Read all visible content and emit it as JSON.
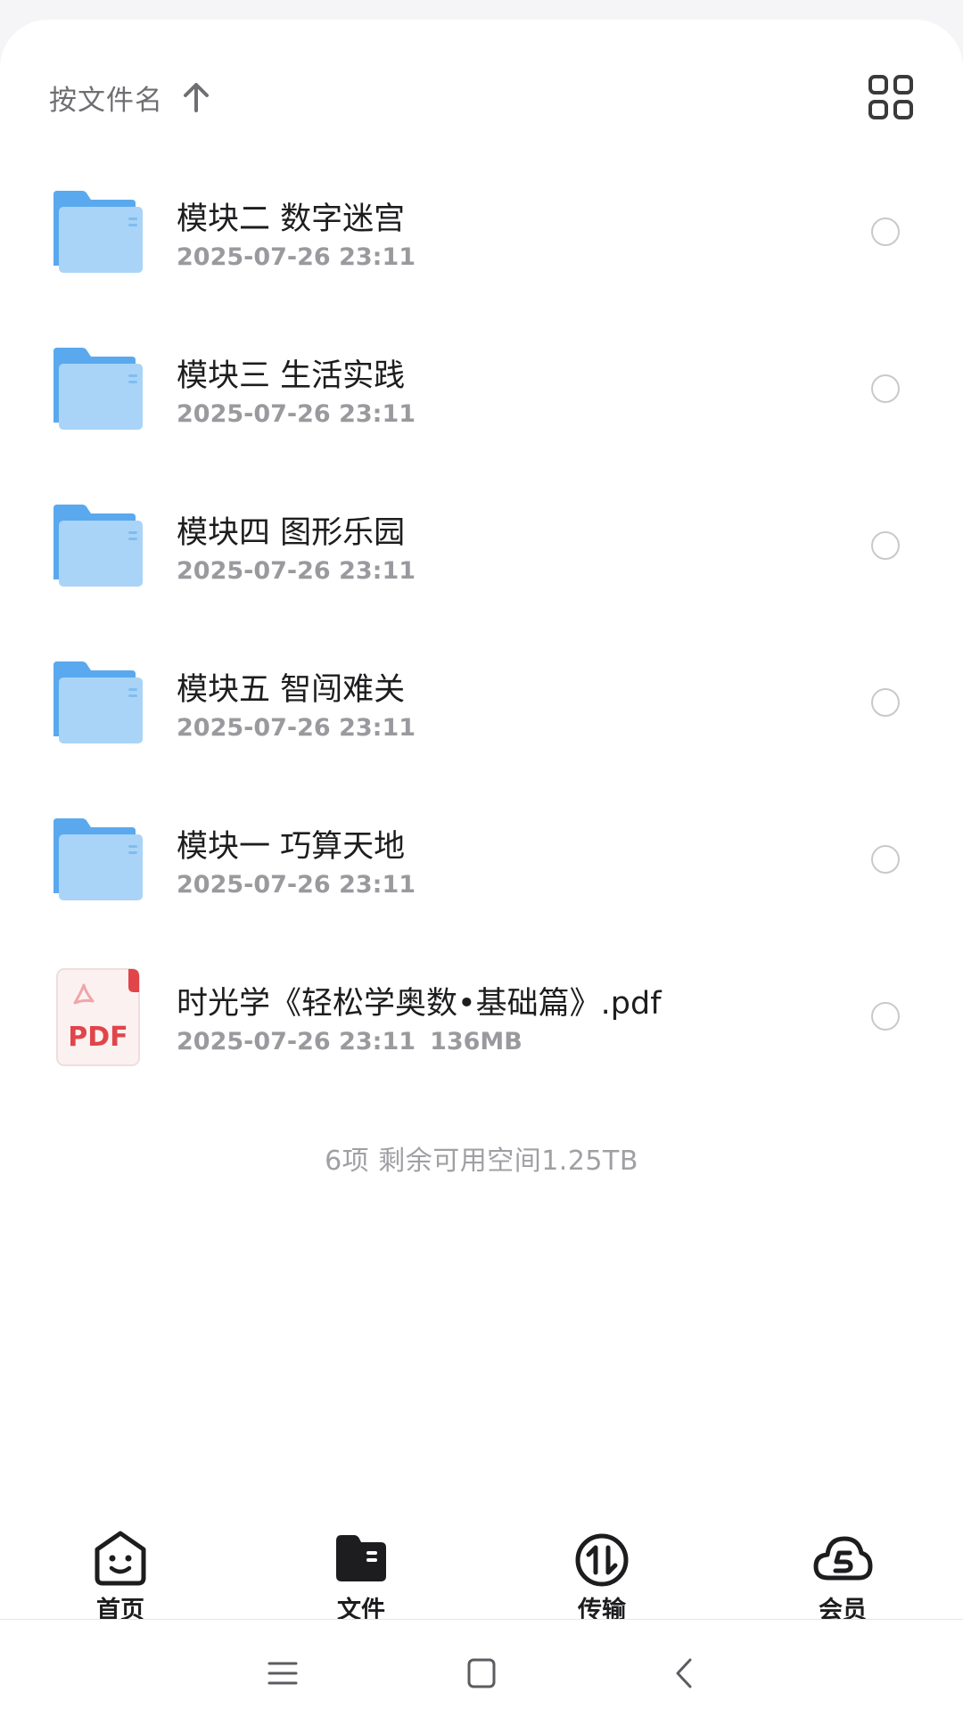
{
  "sort": {
    "label": "按文件名",
    "direction_icon": "arrow-up-icon"
  },
  "view_toggle_icon": "grid-view-icon",
  "files": [
    {
      "type": "folder",
      "icon": "folder-icon",
      "name": "模块二  数字迷宫",
      "date": "2025-07-26 23:11",
      "size": ""
    },
    {
      "type": "folder",
      "icon": "folder-icon",
      "name": "模块三  生活实践",
      "date": "2025-07-26 23:11",
      "size": ""
    },
    {
      "type": "folder",
      "icon": "folder-icon",
      "name": "模块四  图形乐园",
      "date": "2025-07-26 23:11",
      "size": ""
    },
    {
      "type": "folder",
      "icon": "folder-icon",
      "name": "模块五  智闯难关",
      "date": "2025-07-26 23:11",
      "size": ""
    },
    {
      "type": "folder",
      "icon": "folder-icon",
      "name": "模块一  巧算天地",
      "date": "2025-07-26 23:11",
      "size": ""
    },
    {
      "type": "pdf",
      "icon": "pdf-file-icon",
      "icon_text": "PDF",
      "name": "时光学《轻松学奥数•基础篇》.pdf",
      "date": "2025-07-26 23:11",
      "size": "136MB"
    }
  ],
  "summary": "6项 剩余可用空间1.25TB",
  "tabs": [
    {
      "id": "home",
      "label": "首页",
      "icon": "smiley-home-icon",
      "active": false
    },
    {
      "id": "files",
      "label": "文件",
      "icon": "folder-filled-icon",
      "active": true
    },
    {
      "id": "transfer",
      "label": "传输",
      "icon": "transfer-arrows-icon",
      "active": false
    },
    {
      "id": "vip",
      "label": "会员",
      "icon": "cloud-vip-icon",
      "active": false
    }
  ],
  "system_nav": [
    "menu-icon",
    "home-square-icon",
    "back-chevron-icon"
  ],
  "colors": {
    "folder_front": "#a9d4f7",
    "folder_back": "#5aa9ee",
    "pdf_red": "#e0454a",
    "text_primary": "#1d1d1f",
    "text_secondary": "#9a9a9e"
  }
}
